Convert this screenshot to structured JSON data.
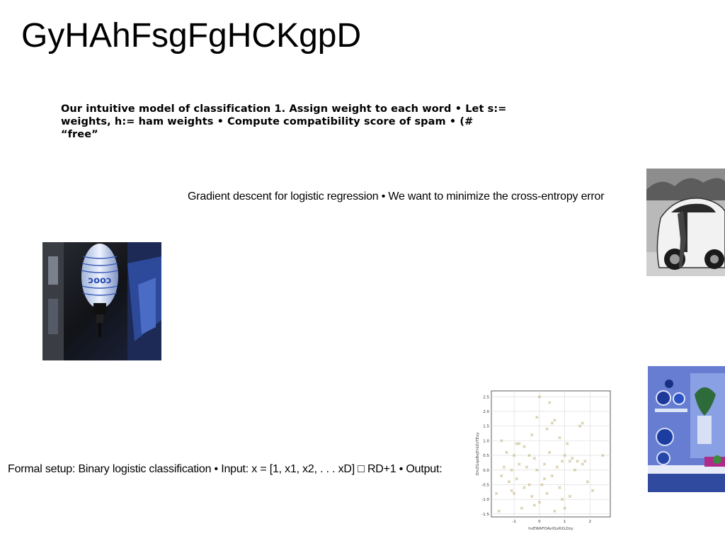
{
  "slide": {
    "title": "GyHAhFsgFgHCKgpD",
    "bold_text": "Our intuitive model of classification 1. Assign weight to each word • Let s:= weights, h:= ham weights • Compute compatibility score of spam • (# “free”",
    "gradient_text": "Gradient descent for logistic regression • We want to minimize the cross-entropy error",
    "formal_text": "Formal setup: Binary logistic classification • Input: x = [1, x1, x2, . . . xD] □ RD+1 • Output:"
  },
  "images": {
    "lantern": "blue paper lantern photo",
    "car": "black and white vintage car photo",
    "kitchen": "blue kitchen with plates photo"
  },
  "chart_data": {
    "type": "scatter",
    "title": "",
    "xlabel": "hvEWAFOAvlQuRXLDzy",
    "ylabel": "ZmZGqoBeJYnIZzTExy",
    "xlim": [
      -1.9,
      2.8
    ],
    "ylim": [
      -1.6,
      2.7
    ],
    "xticks": [
      "-1",
      "0",
      "1",
      "2"
    ],
    "yticks": [
      "2.5",
      "2.0",
      "1.5",
      "1.0",
      "0.5",
      "0.0",
      "-0.5",
      "-1.0",
      "-1.5"
    ],
    "grid": true,
    "marker": "x",
    "color": "#c9b98a",
    "series": [
      {
        "points": [
          [
            -1.6,
            -1.4
          ],
          [
            -1.7,
            -0.8
          ],
          [
            -1.5,
            -0.2
          ],
          [
            -1.4,
            0.1
          ],
          [
            -1.5,
            1.0
          ],
          [
            -1.3,
            0.6
          ],
          [
            -1.2,
            -0.4
          ],
          [
            -1.1,
            0.0
          ],
          [
            -1.0,
            0.5
          ],
          [
            -1.0,
            -0.8
          ],
          [
            -0.9,
            -0.3
          ],
          [
            -0.8,
            0.9
          ],
          [
            -0.8,
            0.2
          ],
          [
            -0.7,
            -1.3
          ],
          [
            -0.6,
            0.8
          ],
          [
            -0.6,
            -0.6
          ],
          [
            -0.5,
            0.1
          ],
          [
            -0.4,
            -0.5
          ],
          [
            -0.3,
            1.2
          ],
          [
            -0.3,
            -0.9
          ],
          [
            -0.2,
            0.4
          ],
          [
            -0.2,
            -1.2
          ],
          [
            -0.1,
            1.8
          ],
          [
            -0.1,
            0.0
          ],
          [
            0.0,
            -1.1
          ],
          [
            0.0,
            2.5
          ],
          [
            0.1,
            -0.5
          ],
          [
            0.2,
            0.2
          ],
          [
            0.3,
            1.4
          ],
          [
            0.3,
            -0.8
          ],
          [
            0.4,
            2.3
          ],
          [
            0.4,
            0.6
          ],
          [
            0.5,
            1.6
          ],
          [
            0.5,
            -0.2
          ],
          [
            0.6,
            -1.4
          ],
          [
            0.6,
            1.7
          ],
          [
            0.7,
            0.1
          ],
          [
            0.8,
            1.1
          ],
          [
            0.8,
            -0.6
          ],
          [
            0.9,
            0.3
          ],
          [
            0.9,
            -1.0
          ],
          [
            1.0,
            -1.3
          ],
          [
            1.0,
            0.5
          ],
          [
            1.1,
            0.9
          ],
          [
            1.2,
            0.3
          ],
          [
            1.2,
            -0.9
          ],
          [
            1.4,
            0.0
          ],
          [
            1.5,
            0.3
          ],
          [
            1.6,
            1.5
          ],
          [
            1.7,
            1.6
          ],
          [
            1.7,
            0.2
          ],
          [
            1.8,
            0.3
          ],
          [
            1.9,
            -0.4
          ],
          [
            2.1,
            -0.7
          ],
          [
            2.5,
            0.5
          ],
          [
            -0.9,
            0.9
          ],
          [
            -0.4,
            0.5
          ],
          [
            0.2,
            -0.3
          ],
          [
            1.3,
            0.4
          ],
          [
            -1.1,
            -0.7
          ]
        ]
      }
    ]
  }
}
